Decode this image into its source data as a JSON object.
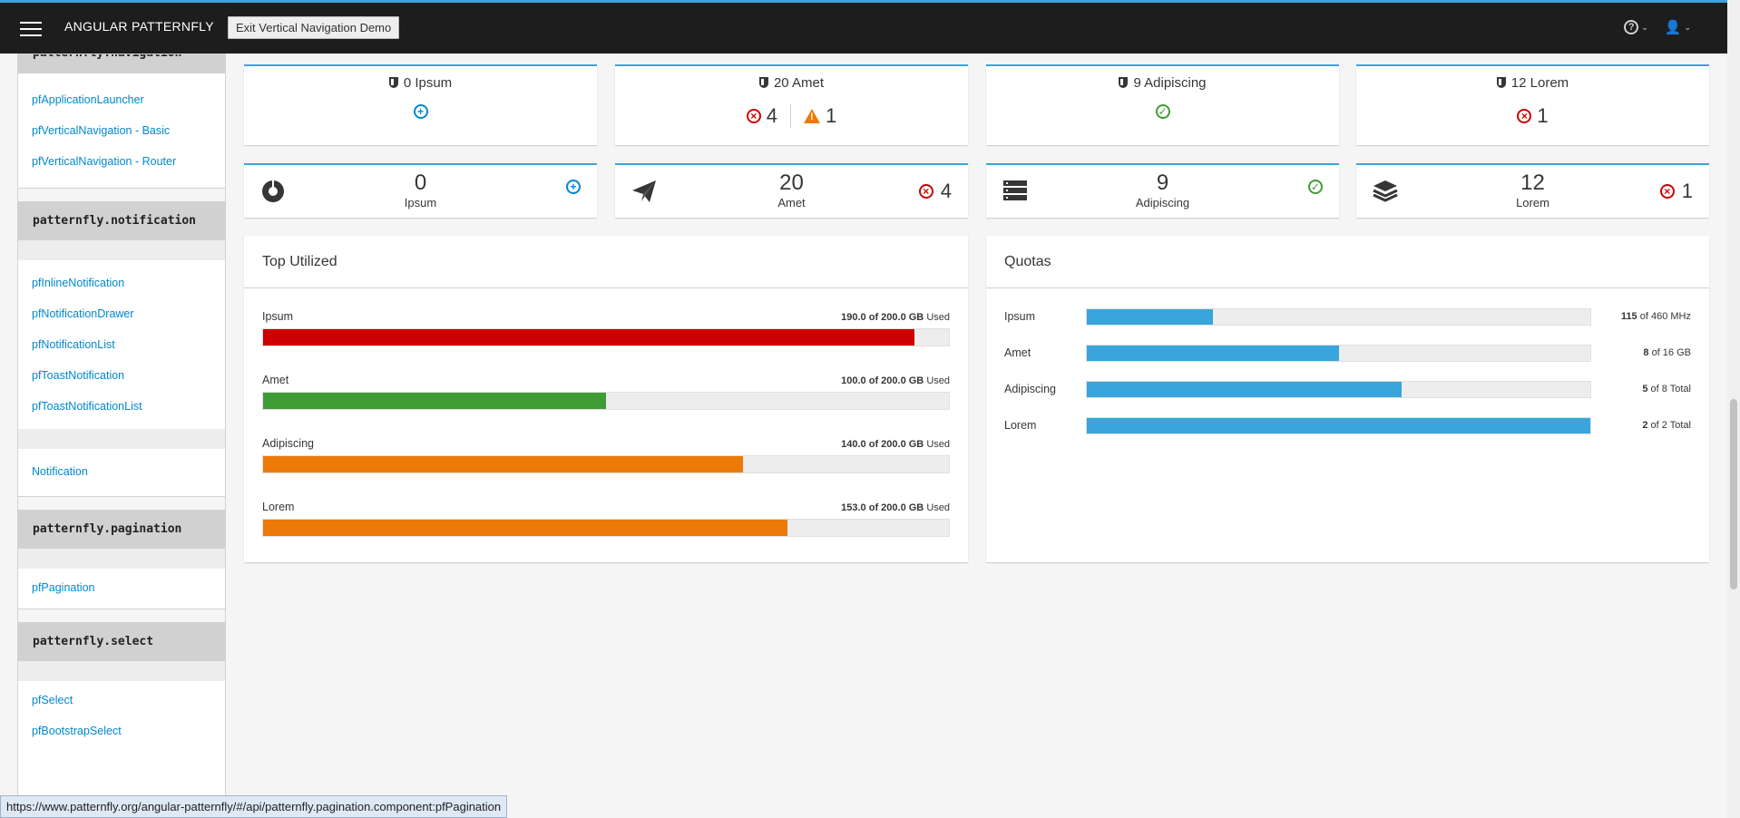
{
  "topbar": {
    "brand": "ANGULAR PATTERNFLY",
    "exit_button": "Exit Vertical Navigation Demo",
    "help_icon": "question-circle-icon",
    "user_icon": "user-icon"
  },
  "sidebar": {
    "partial_heading": "patternfly.navigation",
    "navigation_links": [
      "pfApplicationLauncher",
      "pfVerticalNavigation - Basic",
      "pfVerticalNavigation - Router"
    ],
    "notification_heading": "patternfly.notification",
    "notification_links": [
      "pfInlineNotification",
      "pfNotificationDrawer",
      "pfNotificationList",
      "pfToastNotification",
      "pfToastNotificationList"
    ],
    "notification_extra_link": "Notification",
    "pagination_heading": "patternfly.pagination",
    "pagination_links": [
      "pfPagination"
    ],
    "select_heading": "patternfly.select",
    "select_links": [
      "pfSelect",
      "pfBootstrapSelect"
    ]
  },
  "aggregate_cards": [
    {
      "count": "0",
      "name": "Ipsum",
      "statuses": [
        {
          "icon": "plus-circle-icon",
          "value": ""
        }
      ]
    },
    {
      "count": "20",
      "name": "Amet",
      "statuses": [
        {
          "icon": "error-circle-icon",
          "value": "4"
        },
        {
          "icon": "warning-triangle-icon",
          "value": "1"
        }
      ]
    },
    {
      "count": "9",
      "name": "Adipiscing",
      "statuses": [
        {
          "icon": "ok-circle-icon",
          "value": ""
        }
      ]
    },
    {
      "count": "12",
      "name": "Lorem",
      "statuses": [
        {
          "icon": "error-circle-icon",
          "value": "1"
        }
      ]
    }
  ],
  "mini_cards": [
    {
      "icon": "rebel-icon",
      "count": "0",
      "name": "Ipsum",
      "status_icon": "plus-circle-icon",
      "status_value": ""
    },
    {
      "icon": "paper-plane-icon",
      "count": "20",
      "name": "Amet",
      "status_icon": "error-circle-icon",
      "status_value": "4"
    },
    {
      "icon": "server-icon",
      "count": "9",
      "name": "Adipiscing",
      "status_icon": "ok-circle-icon",
      "status_value": ""
    },
    {
      "icon": "layers-icon",
      "count": "12",
      "name": "Lorem",
      "status_icon": "error-circle-icon",
      "status_value": "1"
    }
  ],
  "top_utilized": {
    "title": "Top Utilized",
    "rows": [
      {
        "label": "Ipsum",
        "used": "190.0",
        "total": "of 200.0 GB",
        "suffix": "Used",
        "percent": 95,
        "color": "#cc0000"
      },
      {
        "label": "Amet",
        "used": "100.0",
        "total": "of 200.0 GB",
        "suffix": "Used",
        "percent": 50,
        "color": "#3f9c35"
      },
      {
        "label": "Adipiscing",
        "used": "140.0",
        "total": "of 200.0 GB",
        "suffix": "Used",
        "percent": 70,
        "color": "#ec7a08"
      },
      {
        "label": "Lorem",
        "used": "153.0",
        "total": "of 200.0 GB",
        "suffix": "Used",
        "percent": 76.5,
        "color": "#ec7a08"
      }
    ]
  },
  "quotas": {
    "title": "Quotas",
    "rows": [
      {
        "label": "Ipsum",
        "used": "115",
        "total": "of 460",
        "unit": "MHz",
        "percent": 25
      },
      {
        "label": "Amet",
        "used": "8",
        "total": "of 16",
        "unit": "GB",
        "percent": 50
      },
      {
        "label": "Adipiscing",
        "used": "5",
        "total": "of 8",
        "unit": "Total",
        "percent": 62.5
      },
      {
        "label": "Lorem",
        "used": "2",
        "total": "of 2",
        "unit": "Total",
        "percent": 100
      }
    ]
  },
  "statusbar": {
    "url": "https://www.patternfly.org/angular-patternfly/#/api/patternfly.pagination.component:pfPagination"
  },
  "colors": {
    "accent": "#39a5dc",
    "link": "#0088ce",
    "error": "#cc0000",
    "ok": "#3f9c35",
    "warning": "#ec7a08"
  }
}
